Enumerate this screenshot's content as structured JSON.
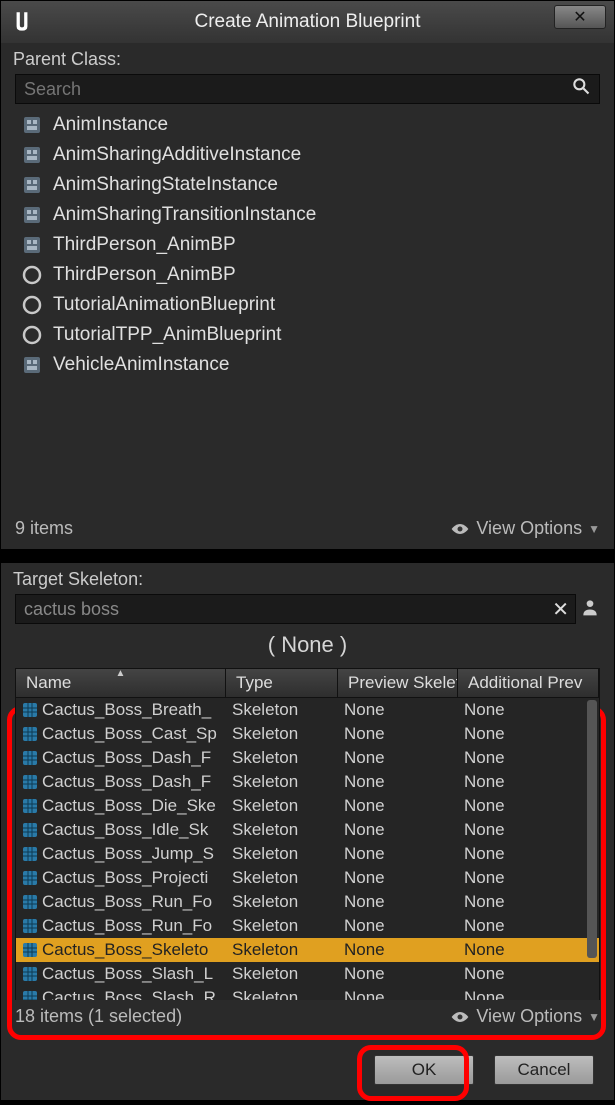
{
  "window": {
    "title": "Create Animation Blueprint"
  },
  "parent_class": {
    "label": "Parent Class:",
    "search_placeholder": "Search",
    "items": [
      {
        "label": "AnimInstance",
        "icon": "class"
      },
      {
        "label": "AnimSharingAdditiveInstance",
        "icon": "class"
      },
      {
        "label": "AnimSharingStateInstance",
        "icon": "class"
      },
      {
        "label": "AnimSharingTransitionInstance",
        "icon": "class"
      },
      {
        "label": "ThirdPerson_AnimBP",
        "icon": "class"
      },
      {
        "label": "ThirdPerson_AnimBP",
        "icon": "blueprint"
      },
      {
        "label": "TutorialAnimationBlueprint",
        "icon": "blueprint"
      },
      {
        "label": "TutorialTPP_AnimBlueprint",
        "icon": "blueprint"
      },
      {
        "label": "VehicleAnimInstance",
        "icon": "class"
      }
    ],
    "count_text": "9 items",
    "view_options": "View Options"
  },
  "target_skeleton": {
    "label": "Target Skeleton:",
    "search_value": "cactus boss",
    "none_heading": "( None )",
    "columns": {
      "name": "Name",
      "type": "Type",
      "preview": "Preview Skeletal",
      "additional": "Additional Prev"
    },
    "rows": [
      {
        "name": "Cactus_Boss_Breath_",
        "type": "Skeleton",
        "preview": "None",
        "additional": "None",
        "selected": false
      },
      {
        "name": "Cactus_Boss_Cast_Sp",
        "type": "Skeleton",
        "preview": "None",
        "additional": "None",
        "selected": false
      },
      {
        "name": "Cactus_Boss_Dash_F",
        "type": "Skeleton",
        "preview": "None",
        "additional": "None",
        "selected": false
      },
      {
        "name": "Cactus_Boss_Dash_F",
        "type": "Skeleton",
        "preview": "None",
        "additional": "None",
        "selected": false
      },
      {
        "name": "Cactus_Boss_Die_Ske",
        "type": "Skeleton",
        "preview": "None",
        "additional": "None",
        "selected": false
      },
      {
        "name": "Cactus_Boss_Idle_Sk",
        "type": "Skeleton",
        "preview": "None",
        "additional": "None",
        "selected": false
      },
      {
        "name": "Cactus_Boss_Jump_S",
        "type": "Skeleton",
        "preview": "None",
        "additional": "None",
        "selected": false
      },
      {
        "name": "Cactus_Boss_Projecti",
        "type": "Skeleton",
        "preview": "None",
        "additional": "None",
        "selected": false
      },
      {
        "name": "Cactus_Boss_Run_Fo",
        "type": "Skeleton",
        "preview": "None",
        "additional": "None",
        "selected": false
      },
      {
        "name": "Cactus_Boss_Run_Fo",
        "type": "Skeleton",
        "preview": "None",
        "additional": "None",
        "selected": false
      },
      {
        "name": "Cactus_Boss_Skeleto",
        "type": "Skeleton",
        "preview": "None",
        "additional": "None",
        "selected": true
      },
      {
        "name": "Cactus_Boss_Slash_L",
        "type": "Skeleton",
        "preview": "None",
        "additional": "None",
        "selected": false
      },
      {
        "name": "Cactus_Boss_Slash_R",
        "type": "Skeleton",
        "preview": "None",
        "additional": "None",
        "selected": false
      }
    ],
    "count_text": "18 items (1 selected)",
    "view_options": "View Options"
  },
  "buttons": {
    "ok": "OK",
    "cancel": "Cancel"
  }
}
